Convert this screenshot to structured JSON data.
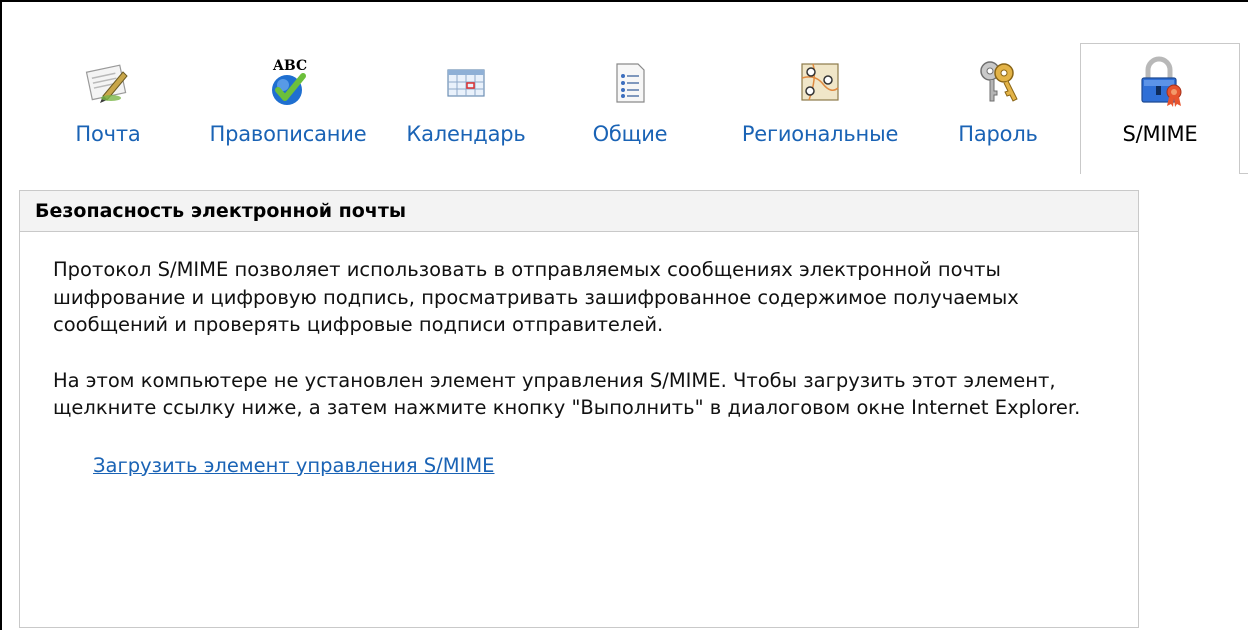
{
  "tabs": [
    {
      "label": "Почта",
      "icon": "mail-pen-icon",
      "active": false
    },
    {
      "label": "Правописание",
      "icon": "spellcheck-icon",
      "active": false
    },
    {
      "label": "Календарь",
      "icon": "calendar-icon",
      "active": false
    },
    {
      "label": "Общие",
      "icon": "general-settings-icon",
      "active": false
    },
    {
      "label": "Региональные",
      "icon": "regional-map-icon",
      "active": false
    },
    {
      "label": "Пароль",
      "icon": "keys-icon",
      "active": false
    },
    {
      "label": "S/MIME",
      "icon": "lock-certificate-icon",
      "active": true
    }
  ],
  "panel": {
    "title": "Безопасность электронной почты",
    "paragraph1": "Протокол S/MIME позволяет использовать в отправляемых сообщениях электронной почты шифрование и цифровую подпись, просматривать зашифрованное содержимое получаемых сообщений и проверять цифровые подписи отправителей.",
    "paragraph2": "На этом компьютере не установлен элемент управления S/MIME. Чтобы загрузить этот элемент, щелкните ссылку ниже, а затем нажмите кнопку \"Выполнить\" в диалоговом окне Internet Explorer.",
    "download_link": "Загрузить элемент управления S/MIME"
  },
  "colors": {
    "link": "#1a63b5",
    "border": "#c9c9c9",
    "header_bg": "#f3f3f3"
  }
}
